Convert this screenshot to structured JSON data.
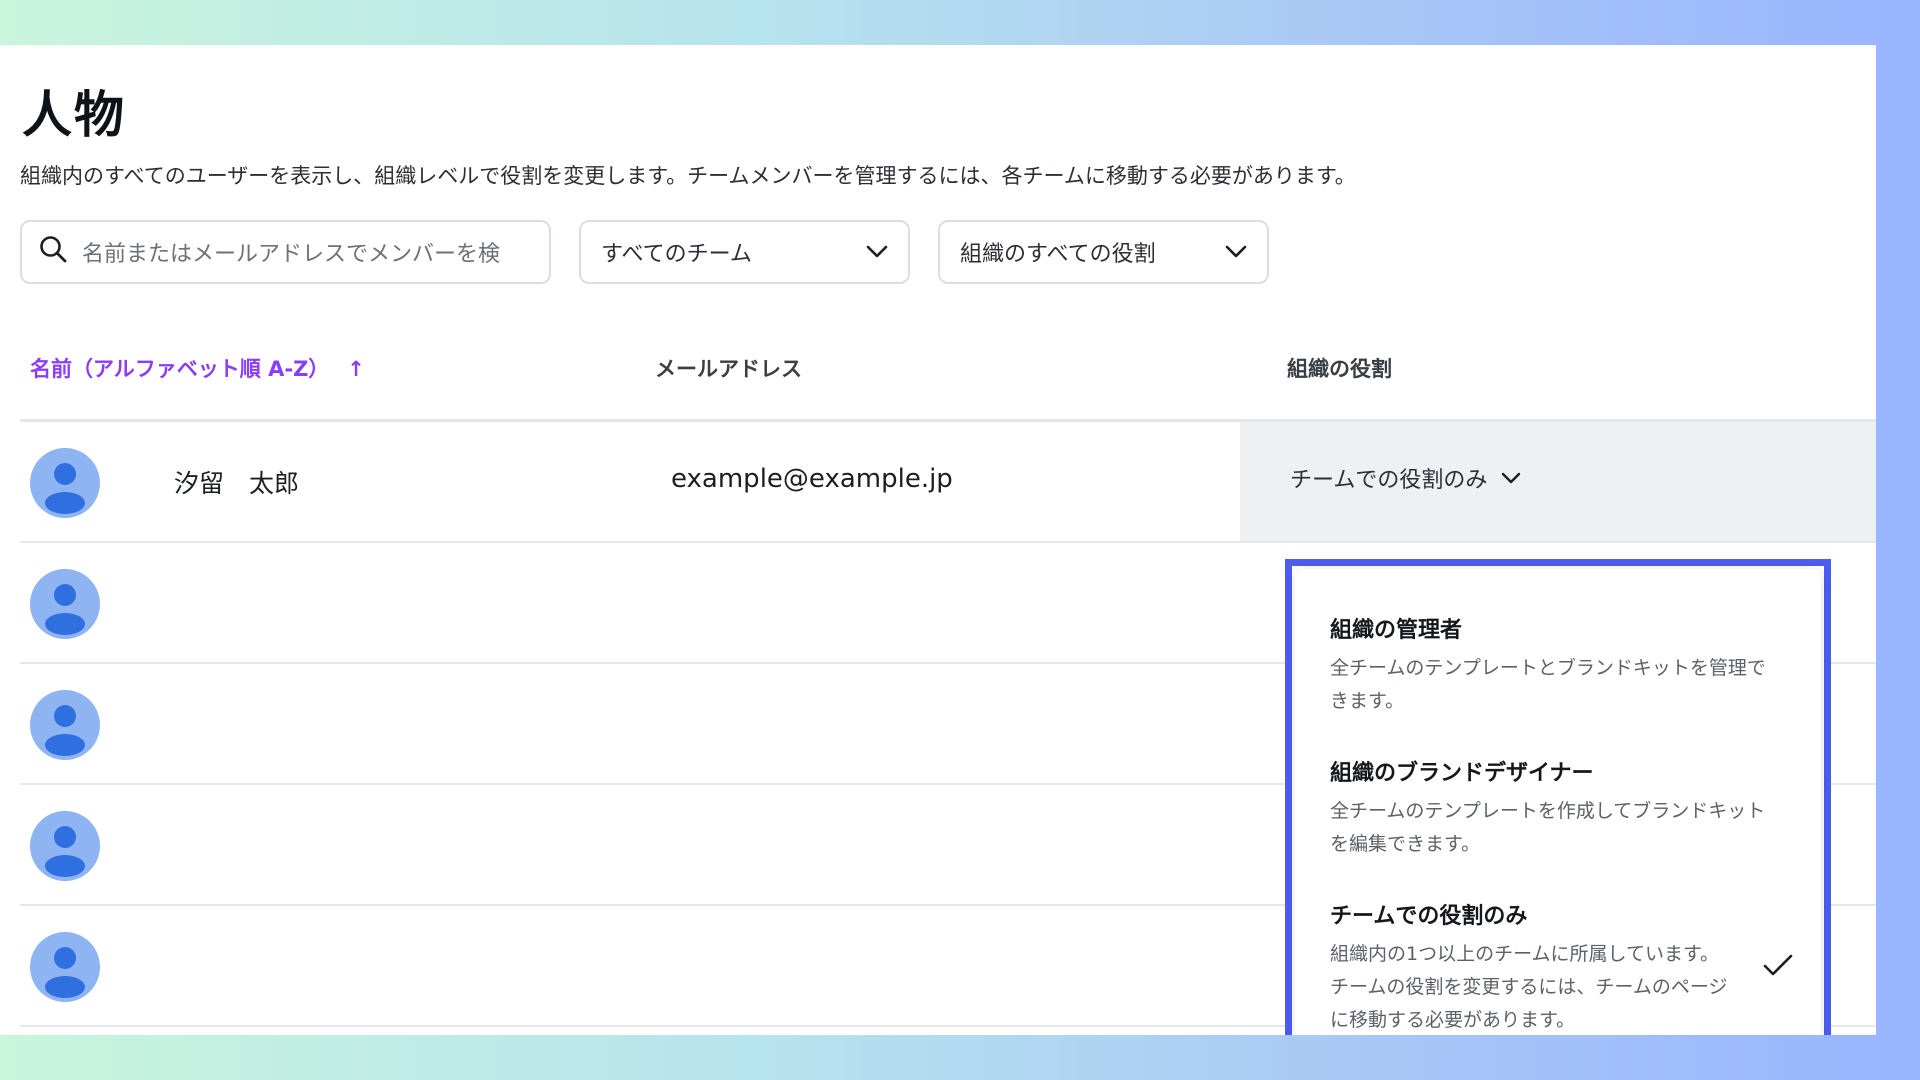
{
  "page": {
    "title": "人物",
    "description": "組織内のすべてのユーザーを表示し、組織レベルで役割を変更します。チームメンバーを管理するには、各チームに移動する必要があります。"
  },
  "filters": {
    "search_placeholder": "名前またはメールアドレスでメンバーを検",
    "team_select": "すべてのチーム",
    "role_select": "組織のすべての役割"
  },
  "table": {
    "columns": {
      "name": "名前（アルファベット順 A-Z）",
      "sort_arrow": "↑",
      "email": "メールアドレス",
      "role": "組織の役割"
    },
    "rows": [
      {
        "name": "汐留　太郎",
        "email": "example@example.jp",
        "role": "チームでの役割のみ"
      },
      {
        "name": "",
        "email": "",
        "role": ""
      },
      {
        "name": "",
        "email": "",
        "role": ""
      },
      {
        "name": "",
        "email": "",
        "role": ""
      },
      {
        "name": "",
        "email": "",
        "role": ""
      }
    ]
  },
  "role_menu": {
    "options": [
      {
        "title": "組織の管理者",
        "desc": "全チームのテンプレートとブランドキットを管理できます。",
        "selected": false
      },
      {
        "title": "組織のブランドデザイナー",
        "desc": "全チームのテンプレートを作成してブランドキットを編集できます。",
        "selected": false
      },
      {
        "title": "チームでの役割のみ",
        "desc": "組織内の1つ以上のチームに所属しています。チームの役割を変更するには、チームのページに移動する必要があります。",
        "selected": true
      }
    ]
  },
  "colors": {
    "accent": "#8b3dff",
    "highlight_border": "#4b5cf0",
    "avatar": "#8fb4f2",
    "avatar_figure": "#2f6fe0"
  },
  "icons": [
    "search-icon",
    "chevron-down-icon",
    "sort-up-arrow-icon",
    "avatar-icon",
    "check-icon"
  ]
}
